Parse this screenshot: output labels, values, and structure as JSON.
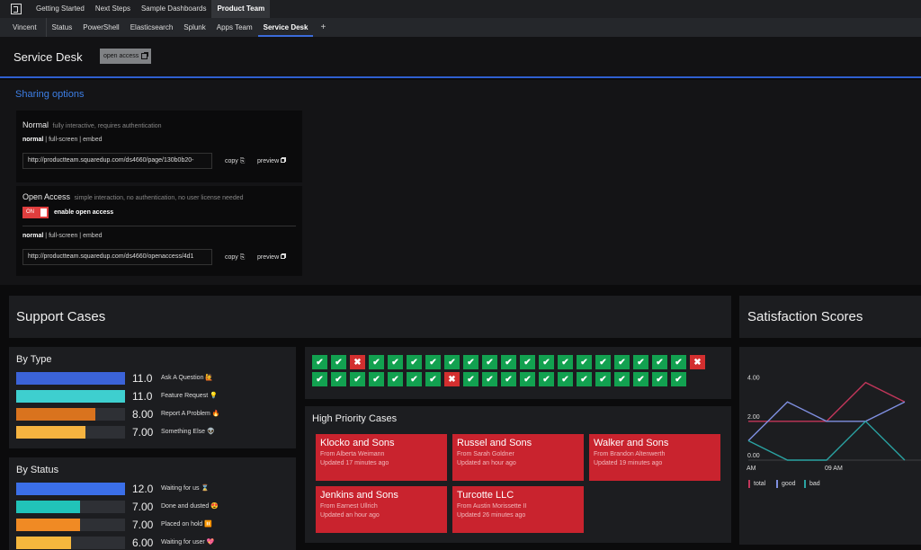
{
  "topnav": {
    "items": [
      "Getting Started",
      "Next Steps",
      "Sample Dashboards",
      "Product Team"
    ],
    "active_index": 3
  },
  "subnav": {
    "user": "Vincent",
    "tabs": [
      "Status",
      "PowerShell",
      "Elasticsearch",
      "Splunk",
      "Apps Team",
      "Service Desk"
    ],
    "active_tab": "Service Desk",
    "add_label": "+"
  },
  "header": {
    "title": "Service Desk",
    "open_access_label": "open access"
  },
  "sharing": {
    "title": "Sharing options",
    "normal": {
      "title": "Normal",
      "desc": "fully interactive, requires authentication",
      "modes": [
        "normal",
        "full-screen",
        "embed"
      ],
      "url": "http://productteam.squaredup.com/ds4660/page/130b0b20-",
      "copy": "copy",
      "preview": "preview"
    },
    "open": {
      "title": "Open Access",
      "desc": "simple interaction, no authentication, no user license needed",
      "toggle": "ON",
      "toggle_label": "enable open access",
      "modes": [
        "normal",
        "full-screen",
        "embed"
      ],
      "url": "http://productteam.squaredup.com/ds4660/openaccess/4d1",
      "copy": "copy",
      "preview": "preview"
    }
  },
  "support": {
    "title": "Support Cases",
    "by_type": {
      "title": "By Type",
      "max": 11,
      "rows": [
        {
          "value": "11.0",
          "num": 11,
          "label": "Ask A Question 🙋",
          "color": "#3b63d8"
        },
        {
          "value": "11.0",
          "num": 11,
          "label": "Feature Request 💡",
          "color": "#3ecfcf"
        },
        {
          "value": "8.00",
          "num": 8,
          "label": "Report A Problem 🔥",
          "color": "#d9731e"
        },
        {
          "value": "7.00",
          "num": 7,
          "label": "Something Else 👽",
          "color": "#f5b340"
        }
      ]
    },
    "by_status": {
      "title": "By Status",
      "max": 12,
      "rows": [
        {
          "value": "12.0",
          "num": 12,
          "label": "Waiting for us ⌛",
          "color": "#3b6fe8"
        },
        {
          "value": "7.00",
          "num": 7,
          "label": "Done and dusted 😍",
          "color": "#21c3b9"
        },
        {
          "value": "7.00",
          "num": 7,
          "label": "Placed on hold ⏸️",
          "color": "#f08a24"
        },
        {
          "value": "6.00",
          "num": 6,
          "label": "Waiting for user 💖",
          "color": "#f5b73d"
        }
      ]
    },
    "checks": [
      1,
      1,
      0,
      1,
      1,
      1,
      1,
      1,
      1,
      1,
      1,
      1,
      1,
      1,
      1,
      1,
      1,
      1,
      1,
      1,
      0,
      1,
      1,
      1,
      1,
      1,
      1,
      1,
      0,
      1,
      1,
      1,
      1,
      1,
      1,
      1,
      1,
      1,
      1,
      1,
      1
    ],
    "high_priority": {
      "title": "High Priority Cases",
      "cases": [
        {
          "name": "Klocko and Sons",
          "from": "From Alberta Weimann",
          "updated": "Updated 17 minutes ago"
        },
        {
          "name": "Russel and Sons",
          "from": "From Sarah Goldner",
          "updated": "Updated an hour ago"
        },
        {
          "name": "Walker and Sons",
          "from": "From Brandon Altenwerth",
          "updated": "Updated 19 minutes ago"
        },
        {
          "name": "Jenkins and Sons",
          "from": "From Earnest Ullrich",
          "updated": "Updated an hour ago"
        },
        {
          "name": "Turcotte LLC",
          "from": "From Austin Morissette II",
          "updated": "Updated 26 minutes ago"
        }
      ]
    }
  },
  "satisfaction": {
    "title": "Satisfaction Scores"
  },
  "chart_data": {
    "type": "line",
    "x": [
      "AM",
      "",
      "09 AM",
      "",
      ""
    ],
    "yticks": [
      "0.00",
      "2.00",
      "4.00"
    ],
    "ylim": [
      0,
      5
    ],
    "series": [
      {
        "name": "total",
        "color": "#c2365a",
        "values": [
          2,
          2,
          2,
          4,
          3
        ]
      },
      {
        "name": "good",
        "color": "#7f8fe0",
        "values": [
          1,
          3,
          2,
          2,
          3
        ]
      },
      {
        "name": "bad",
        "color": "#2aa3a3",
        "values": [
          1,
          0,
          0,
          2,
          0
        ]
      }
    ]
  }
}
